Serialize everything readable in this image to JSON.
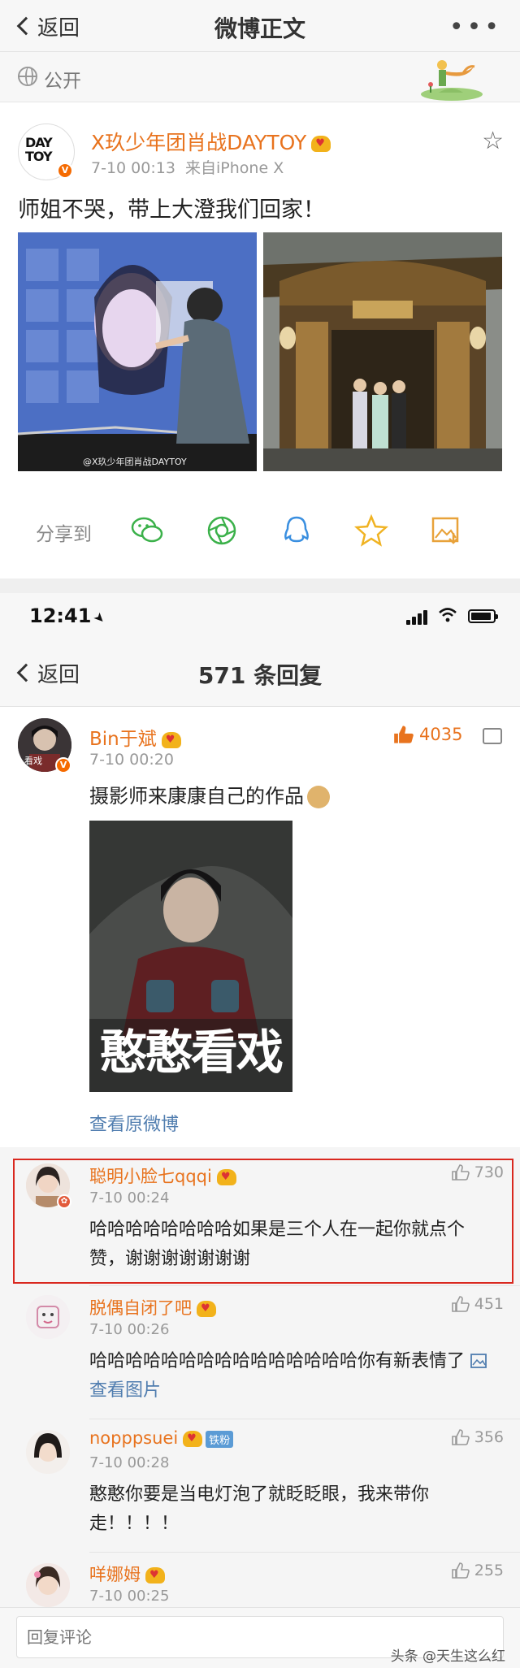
{
  "post_screen": {
    "nav": {
      "back_label": "返回",
      "title": "微博正文",
      "more": "•••"
    },
    "visibility": "公开",
    "author": {
      "name": "X玖少年团肖战DAYTOY",
      "avatar_text": "DAY TOY",
      "date": "7-10 00:13",
      "source": "来自iPhone X"
    },
    "text": "师姐不哭，带上大澄我们回家！",
    "image1_caption": "@X玖少年团肖战DAYTOY",
    "share_label": "分享到",
    "share_icons": [
      "wechat-icon",
      "moments-icon",
      "qq-icon",
      "qzone-star-icon",
      "save-image-icon"
    ]
  },
  "status_bar": {
    "time": "12:41"
  },
  "comments_screen": {
    "nav": {
      "back_label": "返回",
      "title": "571 条回复"
    },
    "main_comment": {
      "name": "Bin于斌",
      "avatar_text": "看戏",
      "date": "7-10 00:20",
      "likes": "4035",
      "text": "摄影师来康康自己的作品",
      "image_caption": "憨憨看戏",
      "view_original": "查看原微博"
    },
    "replies": [
      {
        "name": "聪明小脸七qqqi",
        "date": "7-10 00:24",
        "likes": "730",
        "text": "哈哈哈哈哈哈哈哈如果是三个人在一起你就点个赞，谢谢谢谢谢谢谢"
      },
      {
        "name": "脱偶自闭了吧",
        "date": "7-10 00:26",
        "likes": "451",
        "text": "哈哈哈哈哈哈哈哈哈哈哈哈哈哈哈你有新表情了",
        "view_image": "查看图片"
      },
      {
        "name": "nopppsuei",
        "badge": "铁粉",
        "date": "7-10 00:28",
        "likes": "356",
        "text": "憨憨你要是当电灯泡了就眨眨眼，我来带你走！！！！"
      },
      {
        "name": "咩娜姆",
        "date": "7-10 00:25",
        "likes": "255"
      }
    ],
    "reply_placeholder": "回复评论"
  },
  "watermark": "头条 @天生这么红",
  "colors": {
    "accent_orange": "#e8731e",
    "link_blue": "#507daf",
    "highlight_red": "#d9281f"
  }
}
